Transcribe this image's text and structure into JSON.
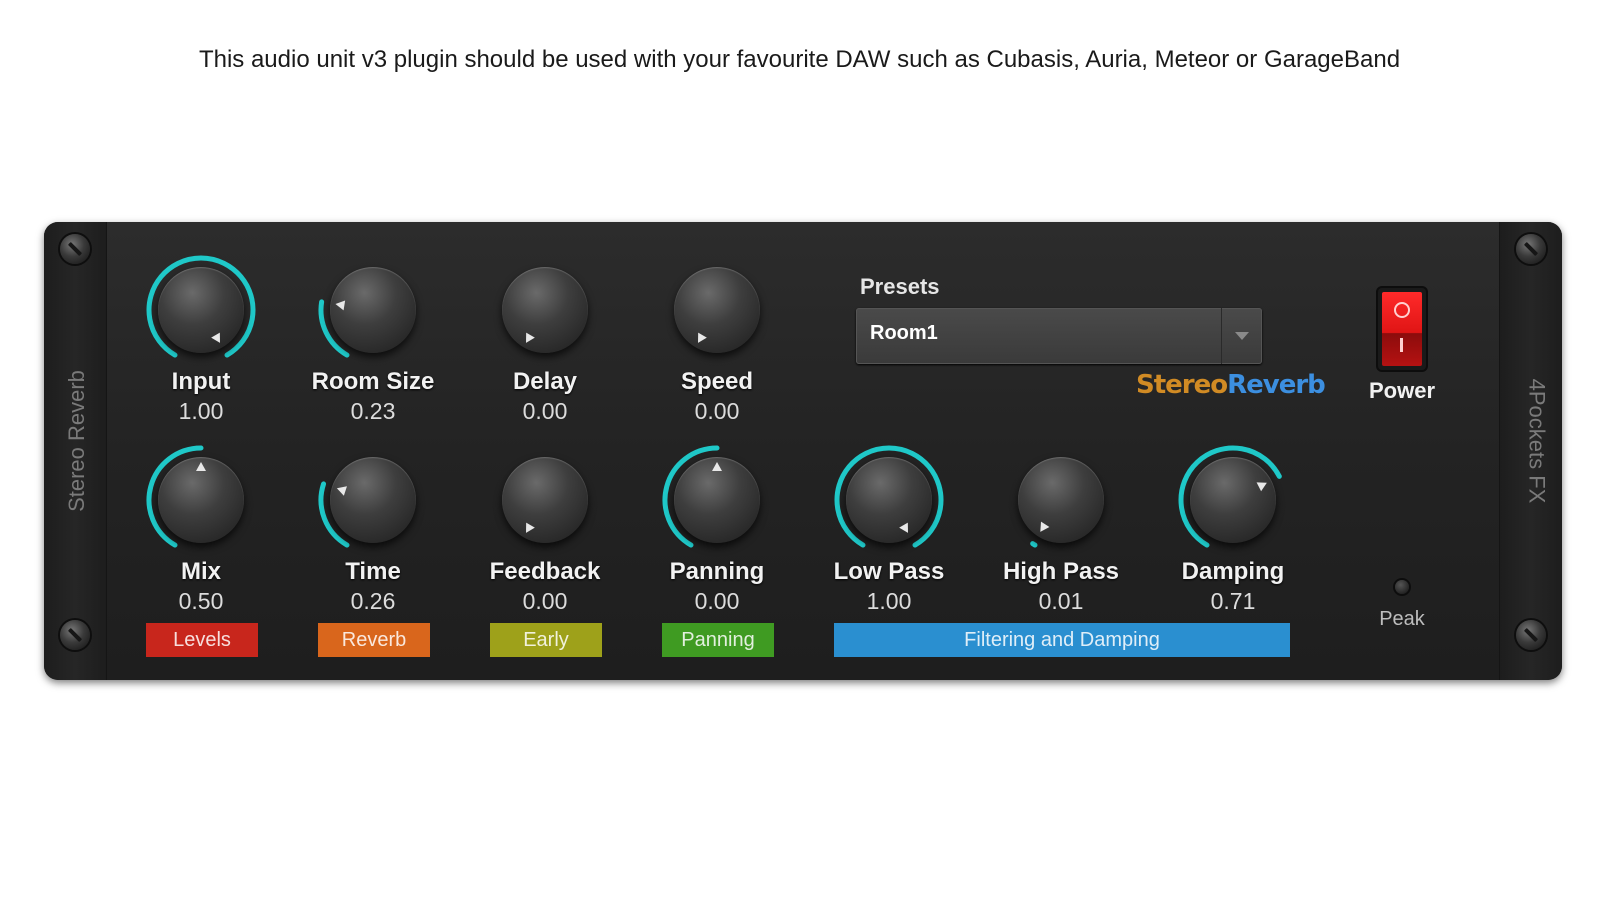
{
  "headline": "This audio unit v3 plugin should be used with your favourite DAW such as Cubasis, Auria, Meteor or GarageBand",
  "plugin": {
    "left_rail_label": "Stereo Reverb",
    "right_rail_label": "4Pockets FX",
    "logo_part1": "Stereo",
    "logo_part2": "Reverb",
    "presets": {
      "label": "Presets",
      "selected": "Room1"
    },
    "power": {
      "label": "Power",
      "state": "on"
    },
    "peak": {
      "label": "Peak"
    }
  },
  "knobs": {
    "input": {
      "name": "Input",
      "value": "1.00",
      "level": 1.0
    },
    "room_size": {
      "name": "Room Size",
      "value": "0.23",
      "level": 0.23
    },
    "delay": {
      "name": "Delay",
      "value": "0.00",
      "level": 0.0
    },
    "speed": {
      "name": "Speed",
      "value": "0.00",
      "level": 0.0
    },
    "mix": {
      "name": "Mix",
      "value": "0.50",
      "level": 0.5
    },
    "time": {
      "name": "Time",
      "value": "0.26",
      "level": 0.26
    },
    "feedback": {
      "name": "Feedback",
      "value": "0.00",
      "level": 0.0
    },
    "panning": {
      "name": "Panning",
      "value": "0.00",
      "level": 0.5
    },
    "low_pass": {
      "name": "Low Pass",
      "value": "1.00",
      "level": 1.0
    },
    "high_pass": {
      "name": "High Pass",
      "value": "0.01",
      "level": 0.01
    },
    "damping": {
      "name": "Damping",
      "value": "0.71",
      "level": 0.71
    }
  },
  "groups": {
    "levels": {
      "label": "Levels",
      "color": "#c8261c"
    },
    "reverb": {
      "label": "Reverb",
      "color": "#d9661c"
    },
    "early": {
      "label": "Early",
      "color": "#9ea11a"
    },
    "panning": {
      "label": "Panning",
      "color": "#3f9b22"
    },
    "filtering": {
      "label": "Filtering and Damping",
      "color": "#2a8fd0"
    }
  },
  "accent_color": "#1fc8c8"
}
